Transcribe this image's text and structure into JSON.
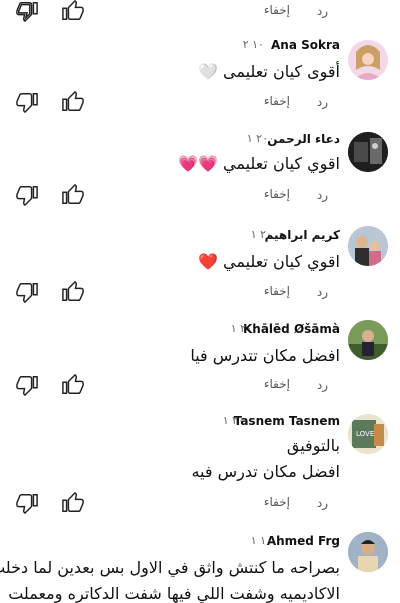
{
  "actions": {
    "reply_label": "رد",
    "hide_label": "إخفاء"
  },
  "comments": [
    {
      "name": "Ana Sokra",
      "time": "١٠ ٢",
      "text": "أقوى كيان تعليمى 🤍"
    },
    {
      "name": "دعاء الرحمن",
      "time": "٢٠ ١",
      "text": "اقوي كيان تعليمي 💗💗"
    },
    {
      "name": "كريم ابراهيم",
      "time": "٢٠ ١",
      "text": "اقوي كيان تعليمي ❤️"
    },
    {
      "name": "Khālēd Øšāmà",
      "time": "٢٠ ١",
      "text": "افضل مكان تتدرس فيا"
    },
    {
      "name": "Tasnem Tasnem",
      "time": "٢٠ ١",
      "line1": "بالتوفيق",
      "line2": "افضل مكان تدرس فيه"
    },
    {
      "name": "Ahmed Frg",
      "time": "١٠ ١",
      "line1": "بصراحه ما كنتش واثق في الاول بس بعدين لما دخلت",
      "line2": "الاكاديميه وشفت اللي فيها شفت الدكاتره ومعملت"
    }
  ]
}
